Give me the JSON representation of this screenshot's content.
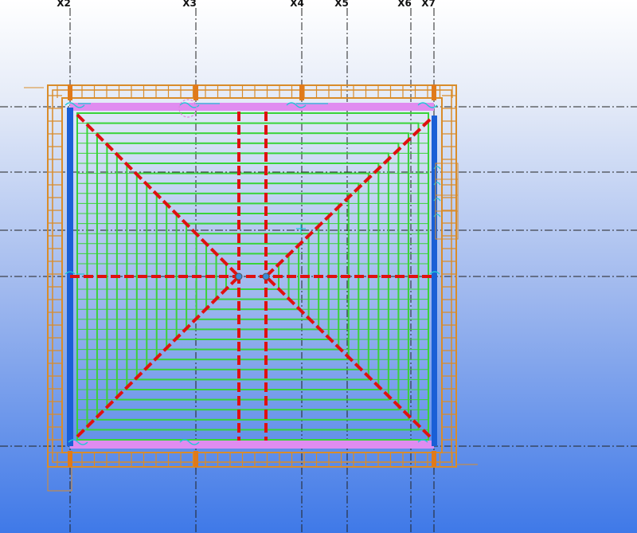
{
  "view": {
    "grid_labels": [
      "X2",
      "X3",
      "X4",
      "X5",
      "X6",
      "X7"
    ]
  },
  "colors": {
    "gridline": "#222222",
    "frame": "#d98c2a",
    "rafters": "#39d439",
    "hip_ridge": "#e01010",
    "wall_plate_side": "#1a5fd6",
    "wall_plate_top": "#e08cf0",
    "annotations": "#22c6d8"
  }
}
